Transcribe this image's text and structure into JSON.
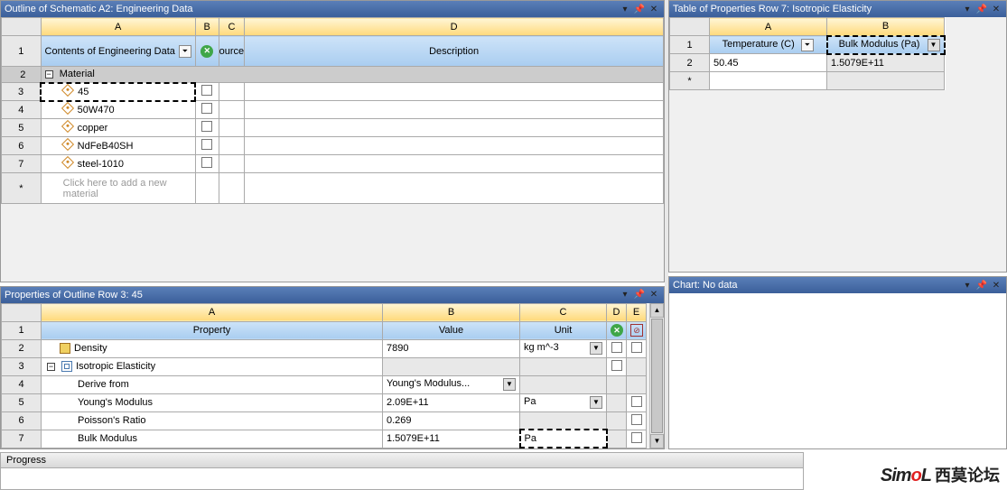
{
  "outline": {
    "title": "Outline of Schematic A2: Engineering Data",
    "columns": {
      "A": "A",
      "B": "B",
      "C": "C",
      "D": "D"
    },
    "headers": {
      "contents": "Contents of Engineering Data",
      "source": "ource",
      "description": "Description"
    },
    "group_label": "Material",
    "rows": [
      {
        "num": "3",
        "name": "45",
        "selected": true
      },
      {
        "num": "4",
        "name": "50W470",
        "selected": false
      },
      {
        "num": "5",
        "name": "copper",
        "selected": false
      },
      {
        "num": "6",
        "name": "NdFeB40SH",
        "selected": false
      },
      {
        "num": "7",
        "name": "steel-1010",
        "selected": false
      }
    ],
    "placeholder": "Click here to add a new material",
    "star": "*",
    "group_row_num": "2",
    "hdr_row_num": "1"
  },
  "properties": {
    "title": "Properties of Outline Row 3: 45",
    "columns": {
      "A": "A",
      "B": "B",
      "C": "C",
      "D": "D",
      "E": "E"
    },
    "headers": {
      "property": "Property",
      "value": "Value",
      "unit": "Unit"
    },
    "hdr_row_num": "1",
    "rows": [
      {
        "num": "2",
        "label": "Density",
        "value": "7890",
        "unit": "kg m^-3",
        "unit_dd": true,
        "icon": "prop",
        "d_chk": true,
        "e_chk": true
      },
      {
        "num": "3",
        "label": "Isotropic Elasticity",
        "value": "",
        "unit": "",
        "group": true,
        "icon": "iso",
        "d_chk": true,
        "e_gray": true
      },
      {
        "num": "4",
        "label": "Derive from",
        "value": "Young's Modulus...",
        "value_dd": true,
        "unit_gray": true,
        "d_gray": true,
        "e_gray": true,
        "indent": true
      },
      {
        "num": "5",
        "label": "Young's Modulus",
        "value": "2.09E+11",
        "unit": "Pa",
        "unit_dd": true,
        "d_gray": true,
        "e_chk": true,
        "indent": true
      },
      {
        "num": "6",
        "label": "Poisson's Ratio",
        "value": "0.269",
        "unit_gray": true,
        "d_gray": true,
        "e_chk": true,
        "indent": true
      },
      {
        "num": "7",
        "label": "Bulk Modulus",
        "value": "1.5079E+11",
        "unit": "Pa",
        "unit_sel": true,
        "d_gray": true,
        "e_chk": true,
        "indent": true,
        "row_sel": true
      }
    ]
  },
  "table_props": {
    "title": "Table of Properties Row 7: Isotropic Elasticity",
    "columns": {
      "A": "A",
      "B": "B"
    },
    "headers": {
      "temp": "Temperature (C)",
      "bulk": "Bulk Modulus (Pa)"
    },
    "hdr_row_num": "1",
    "row": {
      "num": "2",
      "temp": "50.45",
      "bulk": "1.5079E+11"
    },
    "star": "*"
  },
  "chart": {
    "title": "Chart: No data"
  },
  "progress": {
    "title": "Progress"
  },
  "watermark": {
    "logo_pre": "Sim",
    "logo_dot": "o",
    "logo_post": "L",
    "cn": "西莫论坛"
  }
}
